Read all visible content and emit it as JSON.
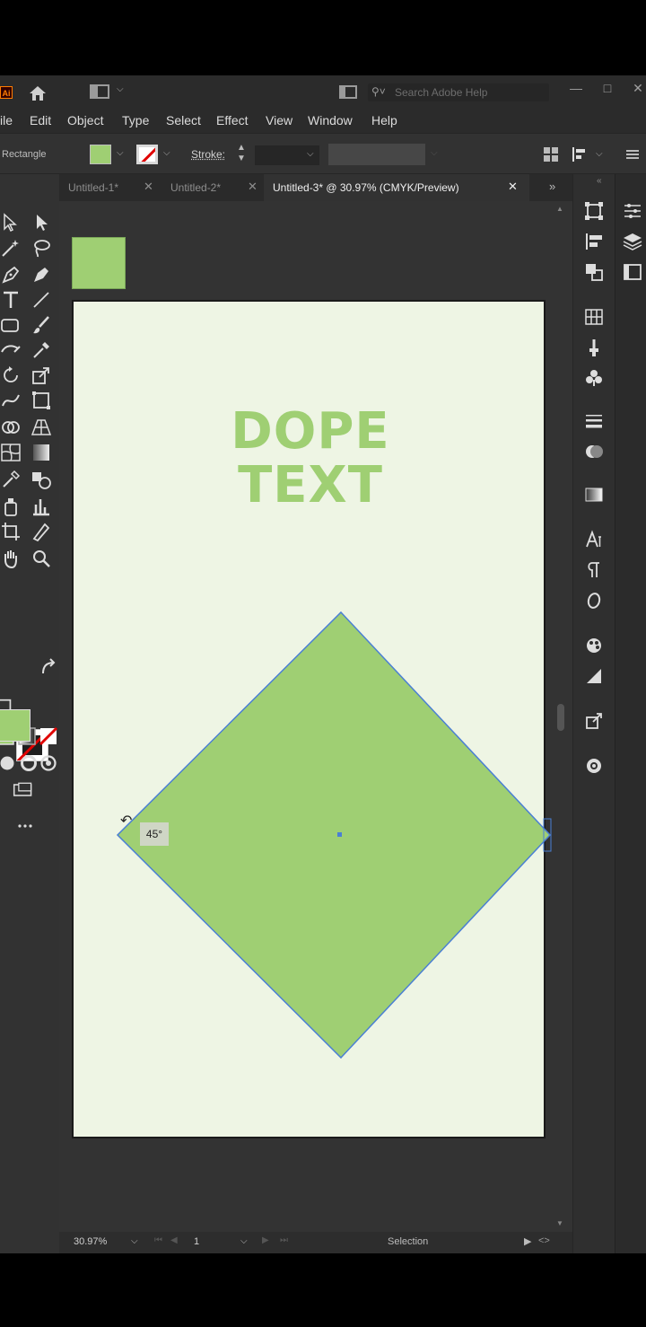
{
  "app": {
    "logo": "Ai",
    "search_placeholder": "Search Adobe Help"
  },
  "menu": [
    "ile",
    "Edit",
    "Object",
    "Type",
    "Select",
    "Effect",
    "View",
    "Window",
    "Help"
  ],
  "control_bar": {
    "selection_label": "Rectangle",
    "fill_color": "#9fcf73",
    "stroke_label": "Stroke:"
  },
  "tabs": [
    {
      "label": "Untitled-1*",
      "active": false
    },
    {
      "label": "Untitled-2*",
      "active": false
    },
    {
      "label": "Untitled-3* @ 30.97% (CMYK/Preview)",
      "active": true
    }
  ],
  "artboard": {
    "background": "#eef5e4",
    "headline_line1": "DOPE",
    "headline_line2": "TEXT",
    "shape_fill": "#9fcf73",
    "rotation_tooltip": "45°"
  },
  "status": {
    "zoom": "30.97%",
    "page": "1",
    "tool": "Selection"
  },
  "colors": {
    "accent_green": "#9fcf73",
    "selection_blue": "#4a7fd4"
  }
}
